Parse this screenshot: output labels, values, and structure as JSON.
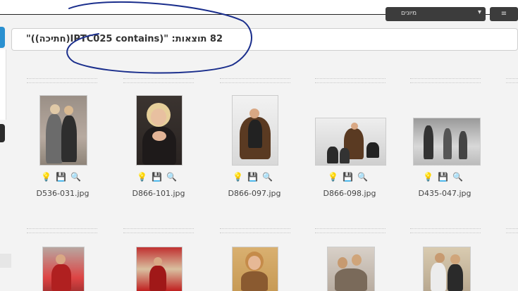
{
  "topbar": {
    "dropdown_label": "מיונים",
    "right_button_label": "≡"
  },
  "results": {
    "text": "82 תוצאות: \"(IPTC025 contains(חתיכה))\""
  },
  "thumbnails": [
    {
      "filename": "D536-031.jpg"
    },
    {
      "filename": "D866-101.jpg"
    },
    {
      "filename": "D866-097.jpg"
    },
    {
      "filename": "D866-098.jpg"
    },
    {
      "filename": "D435-047.jpg"
    }
  ],
  "tool_icons": [
    "lightbulb-icon",
    "save-icon",
    "magnifier-icon"
  ],
  "colors": {
    "annotation": "#1a2e8c",
    "accent_tab": "#2a90d0"
  }
}
